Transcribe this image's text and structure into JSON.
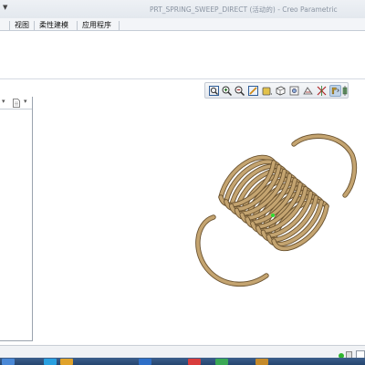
{
  "window": {
    "title": "PRT_SPRING_SWEEP_DIRECT (活动的) - Creo Parametric"
  },
  "menubar": {
    "tabs": [
      {
        "label": "视图"
      },
      {
        "label": "柔性建模"
      },
      {
        "label": "应用程序"
      }
    ]
  },
  "graphics_toolbar": {
    "tools": [
      {
        "icon": "refit-icon"
      },
      {
        "icon": "zoom-in-icon"
      },
      {
        "icon": "zoom-out-icon"
      },
      {
        "icon": "repaint-icon"
      },
      {
        "icon": "display-style-icon"
      },
      {
        "icon": "saved-orientations-icon"
      },
      {
        "icon": "view-manager-icon"
      },
      {
        "icon": "perspective-icon"
      },
      {
        "icon": "datum-display-icon"
      },
      {
        "icon": "annotation-display-icon",
        "active": true
      },
      {
        "icon": "spin-center-icon"
      }
    ]
  },
  "model": {
    "name": "extension spring",
    "color": "#c4a470",
    "edge_color": "#6b5330"
  },
  "status": {
    "indicator_color": "#2fb52f"
  }
}
